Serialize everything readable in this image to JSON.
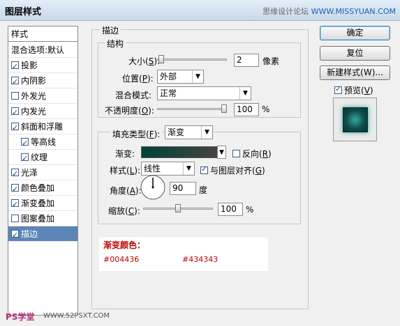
{
  "window": {
    "title": "图层样式"
  },
  "watermark": {
    "text": "思缘设计论坛",
    "url": "WWW.MISSYUAN.COM"
  },
  "sidebar": {
    "header": "样式",
    "items": [
      {
        "label": "混合选项:默认",
        "checkbox": false,
        "checked": false,
        "indent": false,
        "selected": false
      },
      {
        "label": "投影",
        "checkbox": true,
        "checked": true,
        "indent": false,
        "selected": false
      },
      {
        "label": "内阴影",
        "checkbox": true,
        "checked": true,
        "indent": false,
        "selected": false
      },
      {
        "label": "外发光",
        "checkbox": true,
        "checked": false,
        "indent": false,
        "selected": false
      },
      {
        "label": "内发光",
        "checkbox": true,
        "checked": true,
        "indent": false,
        "selected": false
      },
      {
        "label": "斜面和浮雕",
        "checkbox": true,
        "checked": true,
        "indent": false,
        "selected": false
      },
      {
        "label": "等高线",
        "checkbox": true,
        "checked": true,
        "indent": true,
        "selected": false
      },
      {
        "label": "纹理",
        "checkbox": true,
        "checked": true,
        "indent": true,
        "selected": false
      },
      {
        "label": "光泽",
        "checkbox": true,
        "checked": true,
        "indent": false,
        "selected": false
      },
      {
        "label": "颜色叠加",
        "checkbox": true,
        "checked": true,
        "indent": false,
        "selected": false
      },
      {
        "label": "渐变叠加",
        "checkbox": true,
        "checked": true,
        "indent": false,
        "selected": false
      },
      {
        "label": "图案叠加",
        "checkbox": true,
        "checked": false,
        "indent": false,
        "selected": false
      },
      {
        "label": "描边",
        "checkbox": true,
        "checked": true,
        "indent": false,
        "selected": true
      }
    ]
  },
  "stroke": {
    "group_title": "描边",
    "structure": {
      "title": "结构",
      "size_label": "大小(",
      "size_key": "S",
      "size_label_end": "):",
      "size_value": "2",
      "size_unit": "像素",
      "size_fraction": 0.02,
      "position_label": "位置(",
      "position_key": "P",
      "position_label_end": "):",
      "position_value": "外部",
      "blend_label": "混合模式:",
      "blend_value": "正常",
      "opacity_label": "不透明度(",
      "opacity_key": "O",
      "opacity_label_end": "):",
      "opacity_value": "100",
      "opacity_unit": "%",
      "opacity_fraction": 1.0
    },
    "fill": {
      "fill_type_label": "填充类型(",
      "fill_type_key": "F",
      "fill_type_label_end": "):",
      "fill_type_value": "渐变",
      "gradient_label": "渐变:",
      "reverse_label": "反向(",
      "reverse_key": "R",
      "reverse_label_end": ")",
      "reverse_checked": false,
      "style_label": "样式(",
      "style_key": "L",
      "style_label_end": "):",
      "style_value": "线性",
      "align_label": "与图层对齐(",
      "align_key": "G",
      "align_label_end": ")",
      "align_checked": true,
      "angle_label": "角度(",
      "angle_key": "A",
      "angle_label_end": "):",
      "angle_value": "90",
      "angle_unit": "度",
      "scale_label": "缩放(",
      "scale_key": "C",
      "scale_label_end": "):",
      "scale_value": "100",
      "scale_unit": "%",
      "scale_fraction": 0.5
    }
  },
  "buttons": {
    "ok": "确定",
    "reset": "复位",
    "new_style": "新建样式(W)...",
    "preview_label": "预览(",
    "preview_key": "V",
    "preview_label_end": ")",
    "preview_checked": true
  },
  "note": {
    "heading": "渐变颜色：",
    "color1": "#004436",
    "color2": "#434343"
  },
  "footer": {
    "logo": "PS学堂",
    "url": "WWW.52PSXT.COM"
  },
  "colors": {
    "selection": "#5b86b7",
    "gradient_start": "#004436",
    "gradient_end": "#434343",
    "note_text": "#c00000"
  }
}
